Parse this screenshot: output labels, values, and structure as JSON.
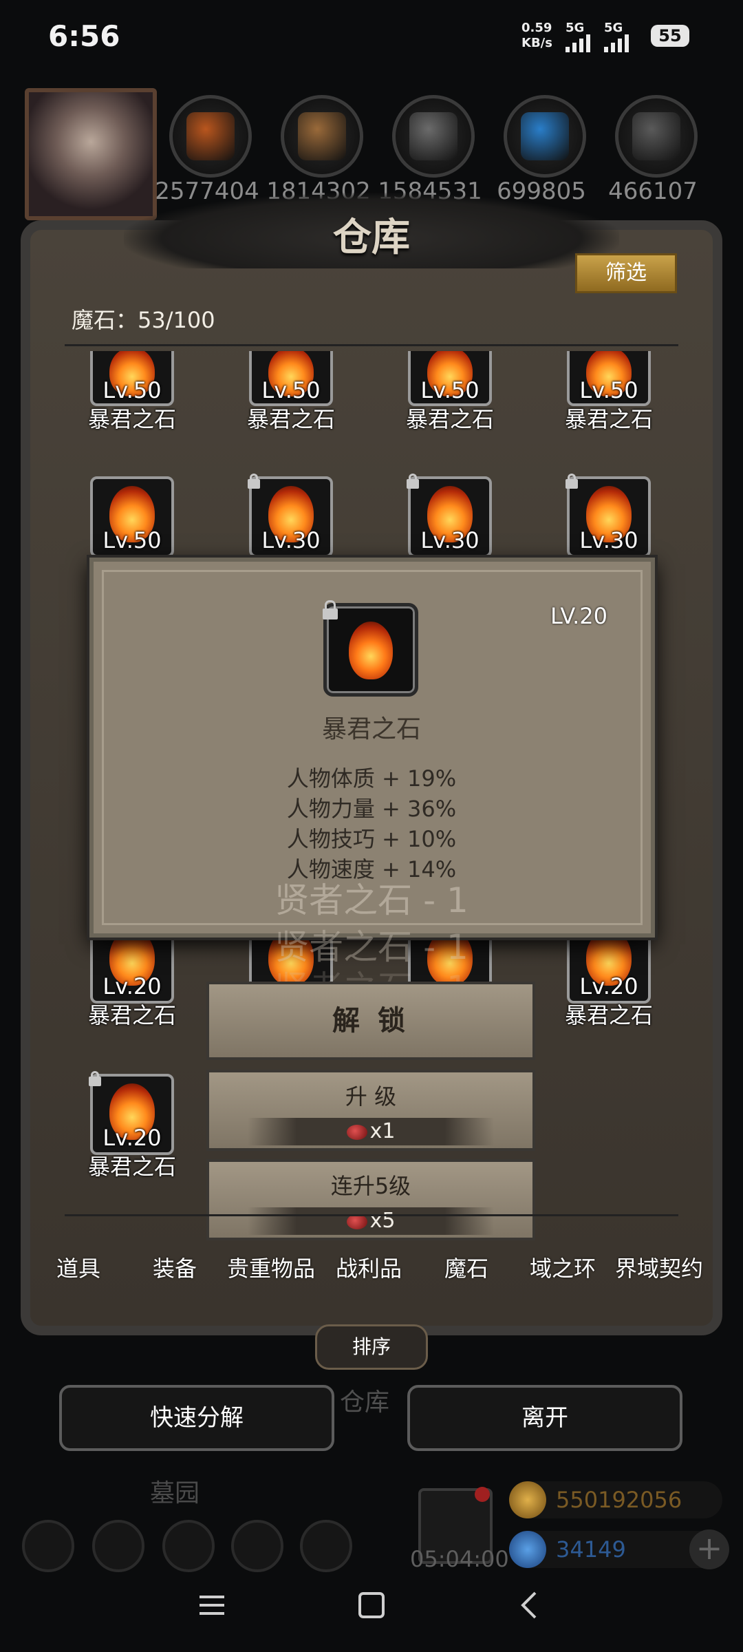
{
  "status": {
    "time": "6:56",
    "net_speed_value": "0.59",
    "net_speed_unit": "KB/s",
    "sim1": "5G",
    "sim2": "5G",
    "battery": "55"
  },
  "resources": [
    "2577404",
    "1814302",
    "1584531",
    "699805",
    "466107"
  ],
  "resource_icon_colors": [
    "#b9561e",
    "#9a6a3a",
    "#6b6b6b",
    "#2a7ec9",
    "#5a5a5a"
  ],
  "warehouse": {
    "title": "仓库",
    "filter_label": "筛选",
    "stone_count_label": "魔石：53/100"
  },
  "grid": {
    "row1": [
      {
        "level": "Lv.50",
        "name": "暴君之石"
      },
      {
        "level": "Lv.50",
        "name": "暴君之石"
      },
      {
        "level": "Lv.50",
        "name": "暴君之石"
      },
      {
        "level": "Lv.50",
        "name": "暴君之石"
      }
    ],
    "row2": [
      {
        "level": "Lv.50",
        "locked": false
      },
      {
        "level": "Lv.30",
        "locked": true
      },
      {
        "level": "Lv.30",
        "locked": true
      },
      {
        "level": "Lv.30",
        "locked": true
      }
    ],
    "row3": [
      {
        "level": "Lv.20",
        "name": "暴君之石"
      },
      {
        "level": "Lv.20",
        "name": "暴君之石"
      }
    ],
    "row4": [
      {
        "level": "Lv.20",
        "name": "暴君之石",
        "locked": true
      }
    ]
  },
  "popup": {
    "level": "LV.20",
    "name": "暴君之石",
    "stats": [
      "人物体质 + 19%",
      "人物力量 + 36%",
      "人物技巧 + 10%",
      "人物速度 + 14%"
    ],
    "ghost_text": [
      "贤者之石 - 1",
      "贤者之石 - 1",
      "贤者之石 - 1"
    ]
  },
  "actions": {
    "unlock": "解 锁",
    "upgrade": "升 级",
    "upgrade_cost": "x1",
    "upgrade5": "连升5级",
    "upgrade5_cost": "x5"
  },
  "tabs": [
    "道具",
    "装备",
    "贵重物品",
    "战利品",
    "魔石",
    "域之环",
    "界域契约"
  ],
  "sort_label": "排序",
  "quick_decompose_label": "快速分解",
  "leave_label": "离开",
  "background": {
    "warehouse_label": "仓库",
    "graveyard_label": "墓园",
    "gift_timer": "05:04:00"
  },
  "currency": {
    "gold": "550192056",
    "gold_color": "#c48a2a",
    "gems": "34149",
    "gems_color": "#2f6fc6"
  },
  "nav": {
    "menu_icon": "menu-icon",
    "home_icon": "home-icon",
    "back_icon": "back-icon"
  }
}
